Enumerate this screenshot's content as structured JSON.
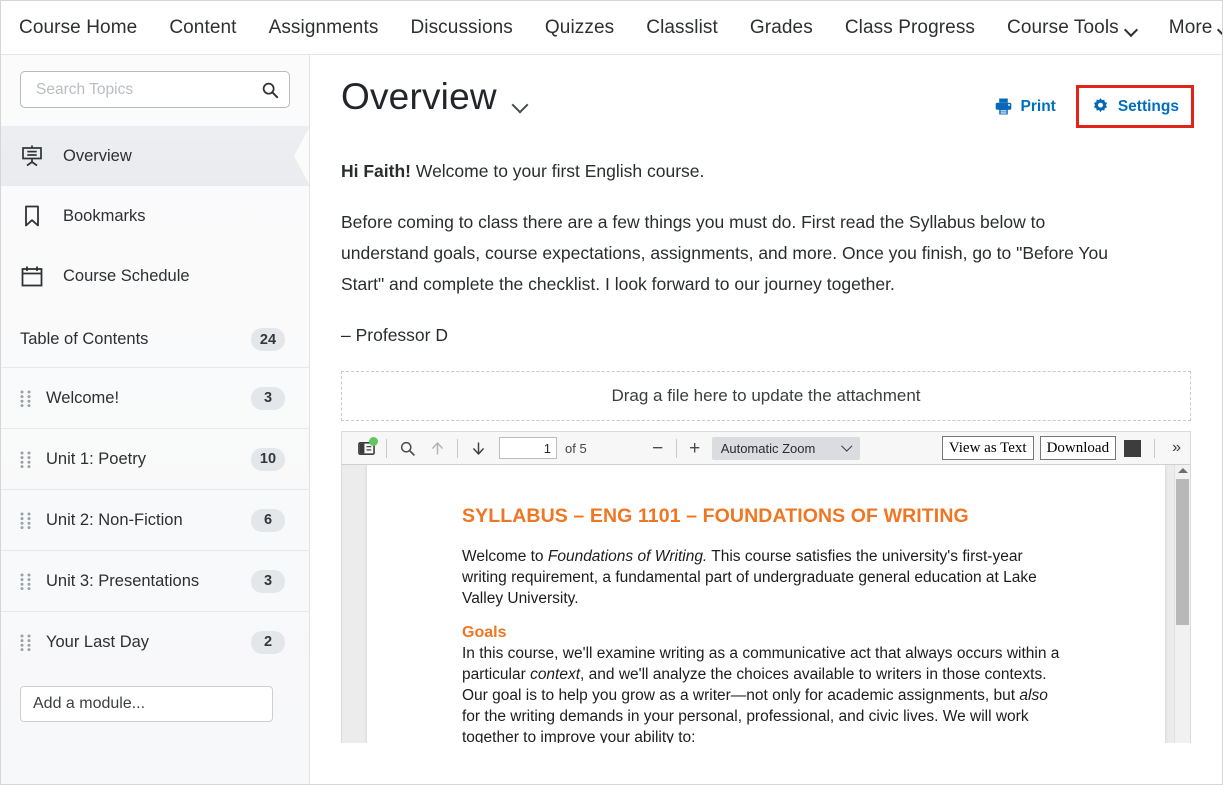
{
  "navbar": {
    "items": [
      {
        "label": "Course Home",
        "caret": false
      },
      {
        "label": "Content",
        "caret": false
      },
      {
        "label": "Assignments",
        "caret": false
      },
      {
        "label": "Discussions",
        "caret": false
      },
      {
        "label": "Quizzes",
        "caret": false
      },
      {
        "label": "Classlist",
        "caret": false
      },
      {
        "label": "Grades",
        "caret": false
      },
      {
        "label": "Class Progress",
        "caret": false
      },
      {
        "label": "Course Tools",
        "caret": true
      },
      {
        "label": "More",
        "caret": true
      }
    ]
  },
  "sidebar": {
    "search": {
      "placeholder": "Search Topics",
      "value": "",
      "icon": "search-icon"
    },
    "links": [
      {
        "label": "Overview",
        "icon": "presentation-screen-icon",
        "active": true
      },
      {
        "label": "Bookmarks",
        "icon": "bookmark-icon",
        "active": false
      },
      {
        "label": "Course Schedule",
        "icon": "calendar-icon",
        "active": false
      }
    ],
    "toc": {
      "label": "Table of Contents",
      "count": "24"
    },
    "modules": [
      {
        "label": "Welcome!",
        "count": "3"
      },
      {
        "label": "Unit 1: Poetry",
        "count": "10"
      },
      {
        "label": "Unit 2: Non-Fiction",
        "count": "6"
      },
      {
        "label": "Unit 3: Presentations",
        "count": "3"
      },
      {
        "label": "Your Last Day",
        "count": "2"
      }
    ],
    "add_module": {
      "label": "Add a module..."
    }
  },
  "main": {
    "title": "Overview",
    "actions": {
      "print": {
        "label": "Print",
        "icon": "printer-icon"
      },
      "settings": {
        "label": "Settings",
        "icon": "gear-icon",
        "highlighted": true
      }
    },
    "paragraphs": {
      "greeting_bold": "Hi Faith!",
      "greeting_rest": " Welcome to your first English course.",
      "instructions": "Before coming to class there are a few things you must do. First read the Syllabus below to understand goals, course expectations, assignments, and more. Once you finish, go to \"Before You Start\" and complete the checklist. I look forward to our journey together.",
      "signature": "– Professor D"
    },
    "dropzone": {
      "label": "Drag a file here to update the attachment"
    }
  },
  "pdf_toolbar": {
    "sidebar_toggle": {
      "icon": "sidebar-toggle-icon",
      "badge": "green-dot"
    },
    "find": {
      "icon": "search-icon"
    },
    "previous_page": {
      "icon": "arrow-up-icon"
    },
    "next_page": {
      "icon": "arrow-down-icon"
    },
    "page_number": "1",
    "page_count_label": "of 5",
    "zoom_out": "−",
    "zoom_in": "+",
    "zoom_select": "Automatic Zoom",
    "view_as_text": "View as Text",
    "download": "Download",
    "more_tools": "»"
  },
  "pdf_document": {
    "title": "SYLLABUS – ENG 1101 – FOUNDATIONS OF WRITING",
    "intro_pre": "Welcome to ",
    "intro_em": "Foundations of Writing.",
    "intro_post": " This course satisfies the university's first-year writing requirement, a fundamental part of undergraduate general education at Lake Valley University.",
    "goals_heading": "Goals",
    "goals_p1": "In this course, we'll examine writing as a communicative act that always occurs within a particular ",
    "goals_em1": "context",
    "goals_p2": ", and we'll analyze the choices available to writers in those contexts. Our goal is to help you grow as a writer—not only for academic assignments, but ",
    "goals_em2": "also",
    "goals_p3": " for the writing demands in your personal, professional, and civic lives. We will work together to improve your ability to:"
  },
  "colors": {
    "link_blue": "#006fbf",
    "highlight_red": "#e2231a",
    "pdf_orange": "#ef7622",
    "badge_gray": "#e4e7ea",
    "green_dot": "#5ec75e"
  }
}
